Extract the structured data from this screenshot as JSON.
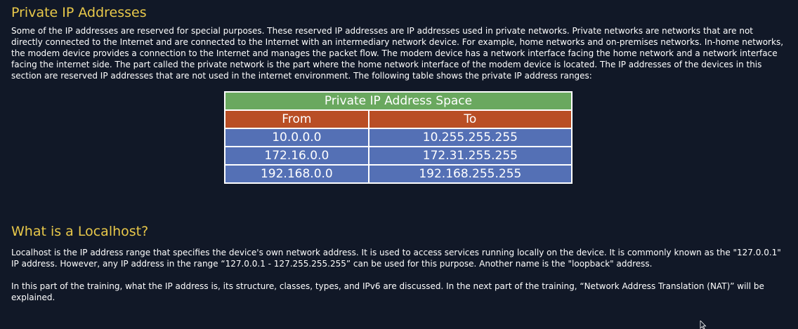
{
  "section1": {
    "heading": "Private IP Addresses",
    "paragraph": "Some of the IP addresses are reserved for special purposes. These reserved IP addresses are IP addresses used in private networks. Private networks are networks that are not directly connected to the Internet and are connected to the Internet with an intermediary network device. For example, home networks and on-premises networks. In-home networks, the modem device provides a connection to the Internet and manages the packet flow. The modem device has a network interface facing the home network and a network interface facing the internet side. The part called the private network is the part where the home network interface of the modem device is located. The IP addresses of the devices in this section are reserved IP addresses that are not used in the internet environment. The following table shows the private IP address ranges:"
  },
  "table": {
    "title": "Private IP Address Space",
    "headers": [
      "From",
      "To"
    ],
    "rows": [
      [
        "10.0.0.0",
        "10.255.255.255"
      ],
      [
        "172.16.0.0",
        "172.31.255.255"
      ],
      [
        "192.168.0.0",
        "192.168.255.255"
      ]
    ],
    "colors": {
      "title_bg": "#6aa85f",
      "header_bg": "#b94e25",
      "cell_bg": "#5470b5"
    }
  },
  "section2": {
    "heading": "What is a Localhost?",
    "paragraph1": "Localhost is the IP address range that specifies the device's own network address. It is used to access services running locally on the device. It is commonly known as the \"127.0.0.1\" IP address. However, any IP address in the range “127.0.0.1 - 127.255.255.255” can be used for this purpose. Another name is the \"loopback\" address.",
    "paragraph2": "In this part of the training, what the IP address is, its structure, classes, types, and IPv6 are discussed. In the next part of the training, “Network Address Translation (NAT)” will be explained."
  },
  "colors": {
    "background": "#111827",
    "heading": "#e8c84a",
    "text": "#ffffff"
  },
  "cursor_icon": "mouse-pointer-icon"
}
